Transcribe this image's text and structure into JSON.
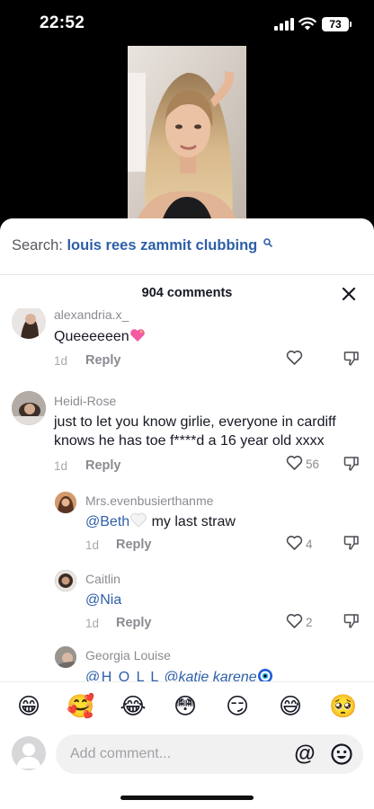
{
  "status_bar": {
    "time": "22:52",
    "battery": "73"
  },
  "search": {
    "label": "Search:",
    "query": "louis rees zammit clubbing"
  },
  "comments_header": {
    "count_label": "904 comments"
  },
  "comments": [
    {
      "username": "alexandria.x_",
      "text": "Queeeeeen",
      "time": "1d",
      "reply_label": "Reply",
      "likes": "",
      "icons": [
        "heart-sparkle-emoji"
      ]
    },
    {
      "username": "Heidi-Rose",
      "text": "just to let you know girlie, everyone in cardiff knows he has toe f****d a 16 year old xxxx",
      "time": "1d",
      "reply_label": "Reply",
      "likes": "56"
    }
  ],
  "replies": [
    {
      "username": "Mrs.evenbusierthanme",
      "mention": "@Beth",
      "text": " my last straw",
      "time": "1d",
      "reply_label": "Reply",
      "likes": "4",
      "icons": [
        "white-heart-emoji"
      ]
    },
    {
      "username": "Caitlin",
      "mention": "@Nia",
      "time": "1d",
      "reply_label": "Reply",
      "likes": "2"
    },
    {
      "username": "Georgia Louise",
      "mention": "@H O L L",
      "mention2": "@katie karene",
      "icons": [
        "nazar-amulet-emoji"
      ]
    }
  ],
  "emoji_bar": [
    "😁",
    "🥰",
    "😂",
    "😳",
    "😏",
    "😅",
    "🥺"
  ],
  "composer": {
    "placeholder": "Add comment...",
    "at_label": "@"
  },
  "colors": {
    "mention": "#2d5fa8",
    "text": "#161823",
    "muted": "#8a8b91"
  }
}
